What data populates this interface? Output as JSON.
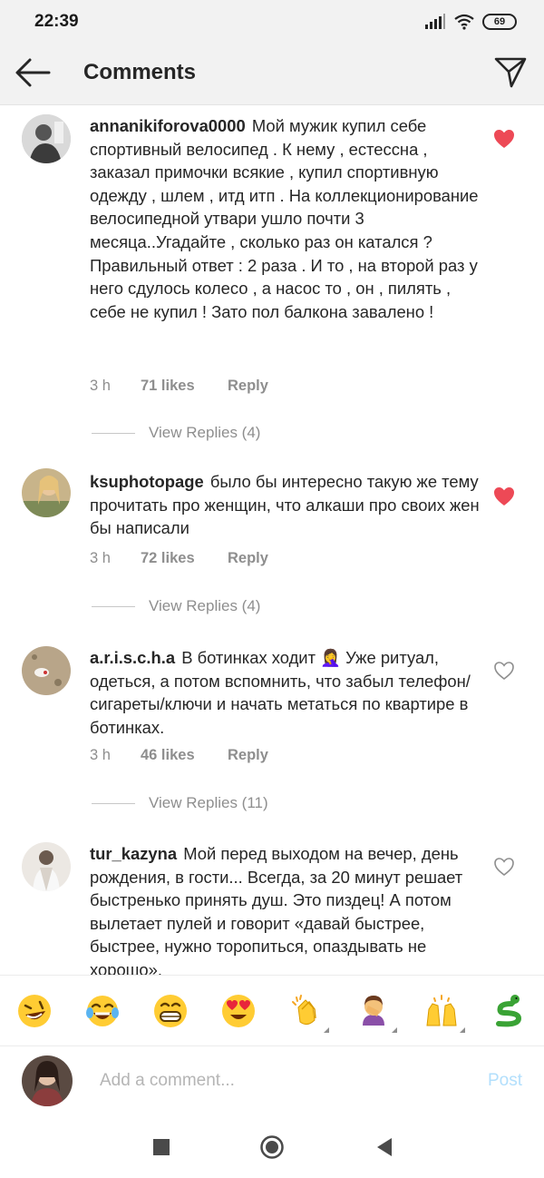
{
  "status_bar": {
    "time": "22:39",
    "battery": "69"
  },
  "header": {
    "title": "Comments",
    "back_icon": "arrow-left-icon",
    "share_icon": "paper-plane-icon"
  },
  "comments": [
    {
      "username": "annanikiforova0000",
      "text": "Мой мужик купил себе спортивный  велосипед . К нему , естессна ,  заказал примочки всякие , купил спортивную одежду , шлем , итд итп . На коллекционирование велосипедной утвари ушло почти 3 месяца..Угадайте , сколько раз он катался ? Правильный ответ : 2 раза . И то , на второй раз у него сдулось колесо , а насос то , он , пилять , себе не купил ! Зато пол балкона завалено !",
      "time": "3 h",
      "likes": "71 likes",
      "reply": "Reply",
      "liked": true,
      "view_replies": "View Replies (4)"
    },
    {
      "username": "ksuphotopage",
      "text": "было бы интересно такую же тему прочитать про женщин, что алкаши про своих жен бы написали",
      "time": "3 h",
      "likes": "72 likes",
      "reply": "Reply",
      "liked": true,
      "view_replies": "View Replies (4)"
    },
    {
      "username": "a.r.i.s.c.h.a",
      "text": "В ботинках ходит 🤦‍♀️ Уже ритуал, одеться, а потом вспомнить, что забыл телефон/сигареты/ключи и начать метаться по квартире в ботинках.",
      "time": "3 h",
      "likes": "46 likes",
      "reply": "Reply",
      "liked": false,
      "view_replies": "View Replies (11)"
    },
    {
      "username": "tur_kazyna",
      "text": "Мой перед выходом на вечер, день рождения, в гости... Всегда, за 20 минут решает быстренько принять душ. Это пиздец! А потом вылетает пулей и говорит «давай быстрее, быстрее, нужно торопиться, опаздывать не хорошо».",
      "liked": false
    }
  ],
  "emoji_bar": [
    "🤣",
    "😂",
    "😁",
    "😍",
    "👏",
    "🤦‍♀️",
    "🙌",
    "🐍"
  ],
  "composer": {
    "placeholder": "Add a comment...",
    "post_label": "Post"
  },
  "colors": {
    "heart_red": "#ed4956",
    "post_blue": "#b2dffc",
    "meta_gray": "#8e8e8e"
  }
}
